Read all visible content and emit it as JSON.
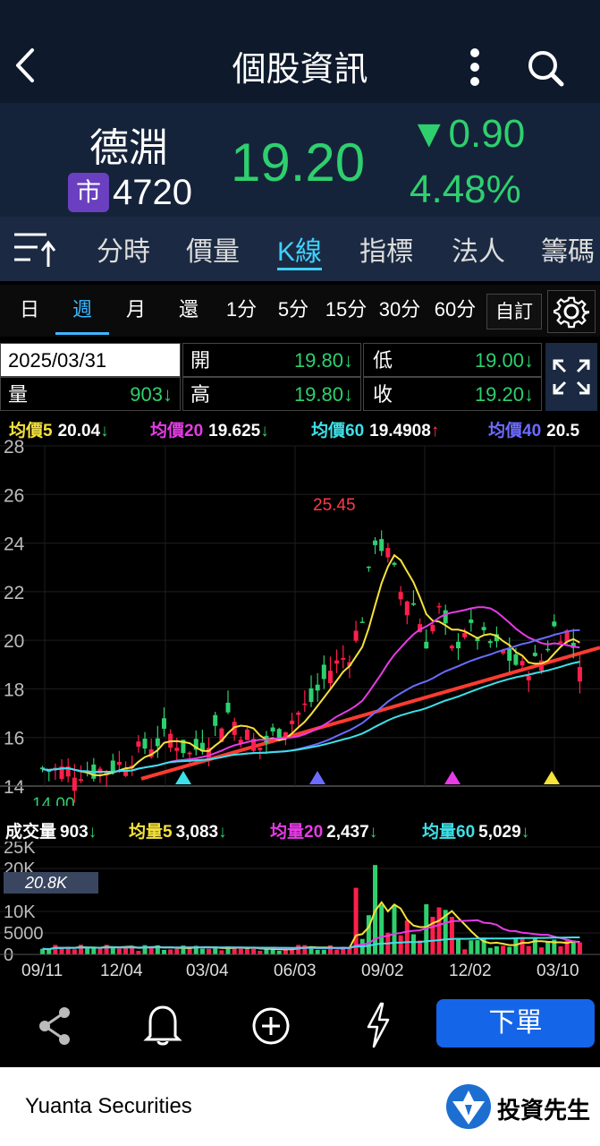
{
  "header": {
    "title": "個股資訊"
  },
  "stock": {
    "name": "德淵",
    "market_badge": "市",
    "code": "4720",
    "price": "19.20",
    "change": "▼0.90",
    "change_pct": "4.48%"
  },
  "tabs": [
    "分時",
    "價量",
    "K線",
    "指標",
    "法人",
    "籌碼"
  ],
  "active_tab": 2,
  "periods": [
    "日",
    "週",
    "月",
    "還",
    "1分",
    "5分",
    "15分",
    "30分",
    "60分"
  ],
  "active_period": 1,
  "custom_label": "自訂",
  "info": {
    "date": "2025/03/31",
    "volume_label": "量",
    "volume": "903↓",
    "open_label": "開",
    "open": "19.80↓",
    "high_label": "高",
    "high": "19.80↓",
    "low_label": "低",
    "low": "19.00↓",
    "close_label": "收",
    "close": "19.20↓"
  },
  "ma_legend": [
    {
      "label": "均價5",
      "value": "20.04",
      "arrow": "↓",
      "color": "#f5e23a",
      "arrow_color": "#2ed06e"
    },
    {
      "label": "均價20",
      "value": "19.625",
      "arrow": "↓",
      "color": "#e63be6",
      "arrow_color": "#2ed06e"
    },
    {
      "label": "均價60",
      "value": "19.4908",
      "arrow": "↑",
      "color": "#3ee0e8",
      "arrow_color": "#ff3b4a"
    },
    {
      "label": "均價40",
      "value": "20.5",
      "arrow": "",
      "color": "#6b6bff",
      "arrow_color": "#2ed06e"
    }
  ],
  "vol_legend": [
    {
      "label": "成交量",
      "value": "903",
      "arrow": "↓",
      "color": "#ffffff"
    },
    {
      "label": "均量5",
      "value": "3,083",
      "arrow": "↓",
      "color": "#f5e23a"
    },
    {
      "label": "均量20",
      "value": "2,437",
      "arrow": "↓",
      "color": "#e63be6"
    },
    {
      "label": "均量60",
      "value": "5,029",
      "arrow": "↓",
      "color": "#3ee0e8"
    }
  ],
  "chart_data": {
    "type": "candlestick",
    "price_axis": {
      "ticks": [
        "28",
        "26",
        "24",
        "22",
        "20",
        "18",
        "16",
        "14"
      ],
      "range": [
        14,
        28
      ]
    },
    "annotations": {
      "high": "25.45",
      "low": "14.00"
    },
    "volume_axis": {
      "ticks": [
        "25K",
        "20K",
        "10K",
        "5000",
        "0"
      ],
      "max": 25000
    },
    "volume_callout": "20.8K",
    "x_labels": [
      "09/11",
      "12/04",
      "03/04",
      "06/03",
      "09/02",
      "12/02",
      "03/10"
    ],
    "candles_count": 85
  },
  "footer": {
    "brand": "Yuanta Securities",
    "app_name": "投資先生"
  },
  "order_button": "下單",
  "colors": {
    "up": "#ff1f4b",
    "down": "#2ed06e",
    "ma5": "#f5e23a",
    "ma20": "#e63be6",
    "ma60": "#3ee0e8",
    "ma40": "#6b6bff",
    "trend": "#ff3b30",
    "accent": "#3fb6ff"
  }
}
